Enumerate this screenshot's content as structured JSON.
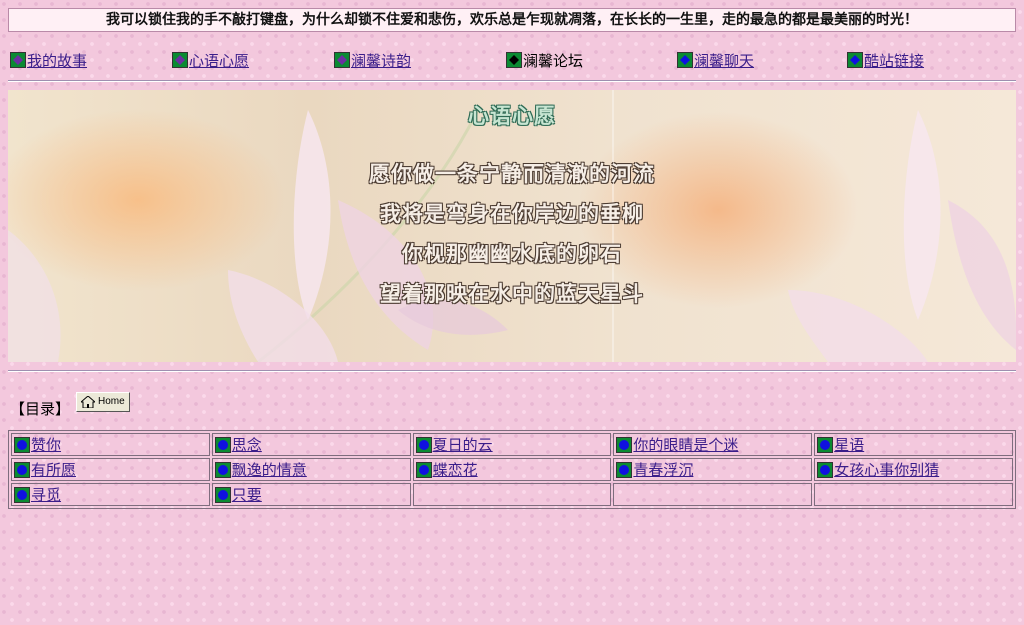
{
  "marquee": {
    "text": "我可以锁住我的手不敲打键盘，为什么却锁不住爱和悲伤，欢乐总是乍现就凋落，在长长的一生里，走的最急的都是最美丽的时光！"
  },
  "nav": {
    "items": [
      {
        "label": "我的故事",
        "link": true,
        "icon": "purple-diamond-icon",
        "color": "#6b2fa0"
      },
      {
        "label": "心语心愿",
        "link": true,
        "icon": "purple-diamond-icon",
        "color": "#6b2fa0"
      },
      {
        "label": "澜馨诗韵",
        "link": true,
        "icon": "purple-diamond-icon",
        "color": "#6b2fa0"
      },
      {
        "label": "澜馨论坛",
        "link": false,
        "icon": "black-diamond-icon",
        "color": "#000000"
      },
      {
        "label": "澜馨聊天",
        "link": true,
        "icon": "blue-diamond-icon",
        "color": "#1010e0"
      },
      {
        "label": "酷站链接",
        "link": true,
        "icon": "blue-diamond-icon",
        "color": "#1010e0"
      }
    ]
  },
  "banner": {
    "title": "心语心愿",
    "poem": [
      "愿你做一条宁静而清澈的河流",
      "我将是弯身在你岸边的垂柳",
      "你枧那幽幽水底的卵石",
      "望着那映在水中的蓝天星斗"
    ]
  },
  "toc": {
    "label": "【目录】",
    "home_button": "Home"
  },
  "grid": {
    "rows": [
      [
        "赞你",
        "思念",
        "夏日的云",
        "你的眼睛是个迷",
        "星语"
      ],
      [
        "有所愿",
        "飘逸的情意",
        "蝶恋花",
        "青春浮沉",
        "女孩心事你别猜"
      ],
      [
        "寻觅",
        "只要",
        "",
        "",
        ""
      ]
    ]
  },
  "colors": {
    "link": "#3a1d8a",
    "bullet_bg": "#0b8a32",
    "bullet_dot": "#1010e0"
  }
}
